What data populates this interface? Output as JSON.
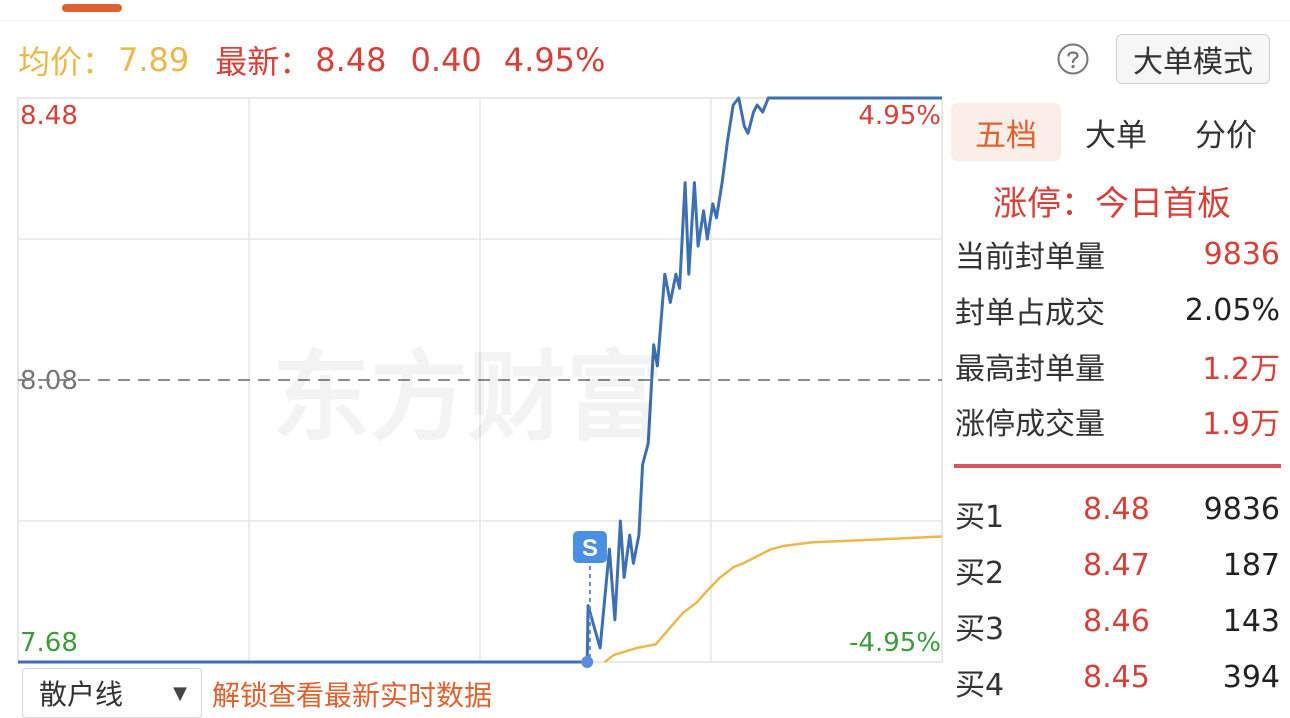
{
  "info_bar": {
    "avg_label": "均价：",
    "avg_value": "7.89",
    "last_label": "最新：",
    "last_value": "8.48",
    "change": "0.40",
    "change_pct": "4.95%"
  },
  "header": {
    "mode_button": "大单模式",
    "help_icon": "help-icon"
  },
  "chart": {
    "price_high": "8.48",
    "price_mid": "8.08",
    "price_low": "7.68",
    "pct_high": "4.95%",
    "pct_low": "-4.95%",
    "watermark": "东方财富",
    "marker": "S",
    "colors": {
      "price_line": "#3d6fb3",
      "avg_line": "#edb74a",
      "up": "#d8403a",
      "down": "#3a9d3a"
    }
  },
  "chart_data": {
    "type": "line",
    "ylim": [
      7.68,
      8.48
    ],
    "y_ref": 8.08,
    "x_unit": "fraction of trading day",
    "series": [
      {
        "name": "",
        "points": [
          [
            0,
            7.68
          ],
          [
            0.616,
            7.68
          ],
          [
            0.617,
            7.76
          ],
          [
            0.63,
            7.7
          ],
          [
            0.64,
            7.84
          ],
          [
            0.646,
            7.74
          ],
          [
            0.652,
            7.88
          ],
          [
            0.656,
            7.8
          ],
          [
            0.662,
            7.86
          ],
          [
            0.666,
            7.82
          ],
          [
            0.672,
            7.86
          ],
          [
            0.676,
            7.96
          ],
          [
            0.682,
            7.99
          ],
          [
            0.688,
            8.13
          ],
          [
            0.692,
            8.1
          ],
          [
            0.7,
            8.23
          ],
          [
            0.706,
            8.19
          ],
          [
            0.712,
            8.23
          ],
          [
            0.716,
            8.21
          ],
          [
            0.722,
            8.36
          ],
          [
            0.726,
            8.23
          ],
          [
            0.732,
            8.36
          ],
          [
            0.736,
            8.27
          ],
          [
            0.742,
            8.32
          ],
          [
            0.746,
            8.28
          ],
          [
            0.752,
            8.33
          ],
          [
            0.756,
            8.31
          ],
          [
            0.762,
            8.36
          ],
          [
            0.768,
            8.42
          ],
          [
            0.774,
            8.47
          ],
          [
            0.78,
            8.48
          ],
          [
            0.786,
            8.44
          ],
          [
            0.79,
            8.43
          ],
          [
            0.796,
            8.46
          ],
          [
            0.8,
            8.47
          ],
          [
            0.806,
            8.46
          ],
          [
            0.812,
            8.48
          ],
          [
            1.0,
            8.48
          ]
        ]
      },
      {
        "name": "",
        "points": [
          [
            0.635,
            7.68
          ],
          [
            0.645,
            7.69
          ],
          [
            0.67,
            7.7
          ],
          [
            0.69,
            7.705
          ],
          [
            0.7,
            7.72
          ],
          [
            0.71,
            7.735
          ],
          [
            0.72,
            7.75
          ],
          [
            0.735,
            7.765
          ],
          [
            0.745,
            7.78
          ],
          [
            0.76,
            7.8
          ],
          [
            0.775,
            7.815
          ],
          [
            0.785,
            7.82
          ],
          [
            0.8,
            7.83
          ],
          [
            0.815,
            7.84
          ],
          [
            0.83,
            7.845
          ],
          [
            0.86,
            7.85
          ],
          [
            0.9,
            7.852
          ],
          [
            0.95,
            7.855
          ],
          [
            1.0,
            7.858
          ]
        ]
      }
    ]
  },
  "bottom": {
    "selector_label": "散户线",
    "caret_icon": "chevron-down-icon",
    "unlock_link": "解锁查看最新实时数据"
  },
  "side": {
    "tabs": [
      {
        "label": "五档"
      },
      {
        "label": "大单"
      },
      {
        "label": "分价"
      }
    ],
    "limit_title": "涨停：今日首板",
    "stats": [
      {
        "label": "当前封单量",
        "value": "9836"
      },
      {
        "label": "封单占成交",
        "value": "2.05%"
      },
      {
        "label": "最高封单量",
        "value": "1.2万"
      },
      {
        "label": "涨停成交量",
        "value": "1.9万"
      }
    ],
    "orders": [
      {
        "label": "买1",
        "price": "8.48",
        "volume": "9836"
      },
      {
        "label": "买2",
        "price": "8.47",
        "volume": "187"
      },
      {
        "label": "买3",
        "price": "8.46",
        "volume": "143"
      },
      {
        "label": "买4",
        "price": "8.45",
        "volume": "394"
      }
    ]
  }
}
